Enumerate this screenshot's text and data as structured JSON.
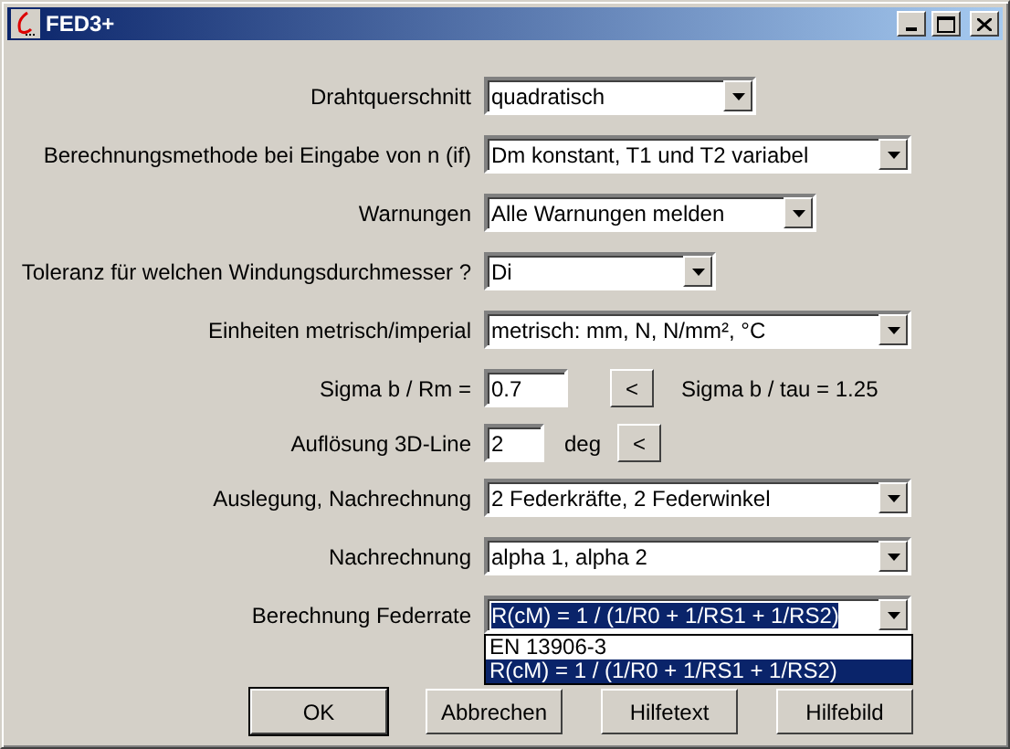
{
  "window": {
    "title": "FED3+"
  },
  "rows": [
    {
      "kind": "combo",
      "label": "Drahtquerschnitt",
      "value": "quadratisch"
    },
    {
      "kind": "combo",
      "label": "Berechnungsmethode bei Eingabe von n (if)",
      "value": "Dm konstant, T1 und T2 variabel"
    },
    {
      "kind": "combo",
      "label": "Warnungen",
      "value": "Alle Warnungen melden"
    },
    {
      "kind": "combo",
      "label": "Toleranz für welchen Windungsdurchmesser ?",
      "value": "Di"
    },
    {
      "kind": "combo",
      "label": "Einheiten metrisch/imperial",
      "value": "metrisch: mm, N, N/mm², °C"
    },
    {
      "kind": "input",
      "label": "Sigma b / Rm =",
      "value": "0.7",
      "button": "<",
      "note": "Sigma b / tau = 1.25"
    },
    {
      "kind": "input",
      "label": "Auflösung 3D-Line",
      "value": "2",
      "unit": "deg",
      "button": "<"
    },
    {
      "kind": "combo",
      "label": "Auslegung, Nachrechnung",
      "value": "2 Federkräfte, 2 Federwinkel"
    },
    {
      "kind": "combo",
      "label": "Nachrechnung",
      "value": "alpha 1, alpha 2"
    },
    {
      "kind": "combo",
      "label": "Berechnung Federrate",
      "value": "R(cM) = 1 / (1/R0 + 1/RS1 + 1/RS2)",
      "focused": true,
      "expanded": true,
      "options": [
        {
          "label": "EN 13906-3",
          "selected": false
        },
        {
          "label": "R(cM) = 1 / (1/R0 + 1/RS1 + 1/RS2)",
          "selected": true
        }
      ]
    }
  ],
  "buttons": [
    {
      "label": "OK",
      "default": true
    },
    {
      "label": "Abbrechen",
      "default": false
    },
    {
      "label": "Hilfetext",
      "default": false
    },
    {
      "label": "Hilfebild",
      "default": false
    }
  ]
}
